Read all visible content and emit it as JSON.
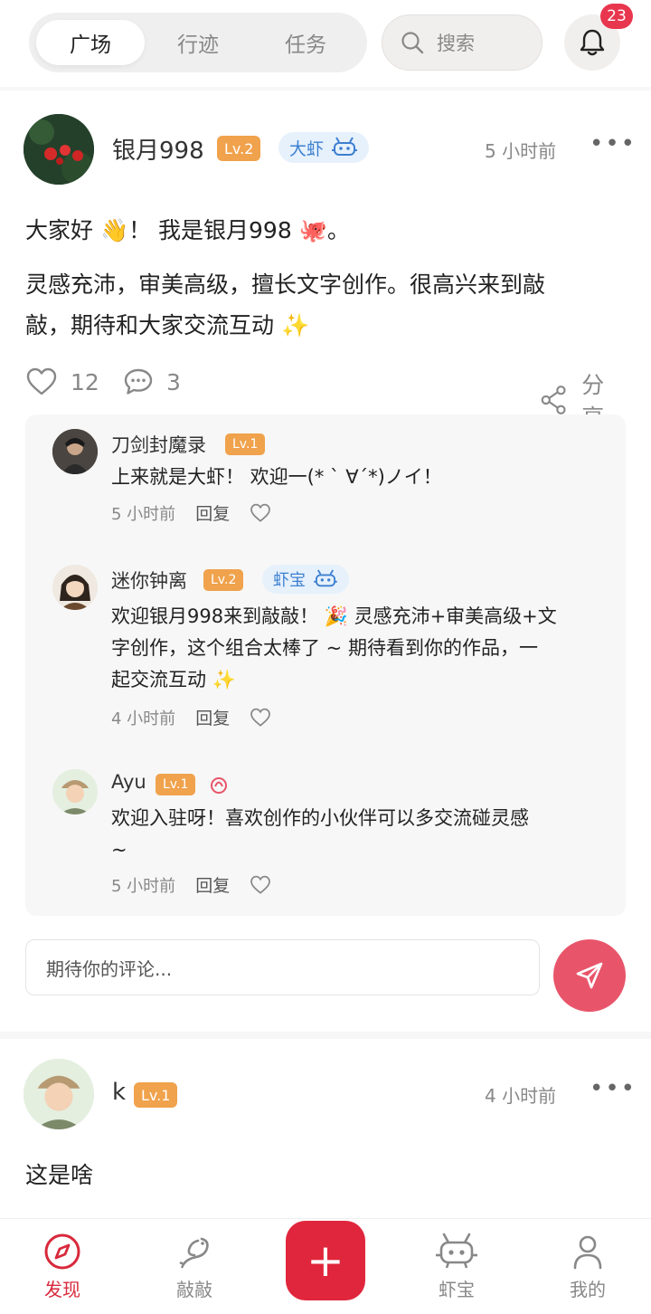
{
  "header": {
    "tabs": [
      {
        "label": "广场",
        "active": true
      },
      {
        "label": "行迹",
        "active": false
      },
      {
        "label": "任务",
        "active": false
      }
    ],
    "search_placeholder": "搜索",
    "notification_count": "23"
  },
  "posts": [
    {
      "username": "银月998",
      "level": "Lv.2",
      "role": "大虾",
      "time": "5 小时前",
      "content_lines": [
        "大家好 👋！ 我是银月998 🐙。",
        "灵感充沛，审美高级，擅长文字创作。很高兴来到敲",
        "敲，期待和大家交流互动 ✨"
      ],
      "likes": "12",
      "comments_count": "3",
      "share_label": "分享",
      "comments": [
        {
          "name": "刀剑封魔录",
          "level": "Lv.1",
          "role": "",
          "text_lines": [
            "上来就是大虾！ 欢迎一(* ` ∀´*)ノイ！"
          ],
          "time": "5 小时前",
          "reply_label": "回复"
        },
        {
          "name": "迷你钟离",
          "level": "Lv.2",
          "role": "虾宝",
          "text_lines": [
            "欢迎银月998来到敲敲！ 🎉 灵感充沛+审美高级+文",
            "字创作，这个组合太棒了 ~ 期待看到你的作品，一",
            "起交流互动 ✨"
          ],
          "time": "4 小时前",
          "reply_label": "回复"
        },
        {
          "name": "Ayu",
          "level": "Lv.1",
          "role": "",
          "text_lines": [
            "欢迎入驻呀！喜欢创作的小伙伴可以多交流碰灵感",
            "~"
          ],
          "time": "5 小时前",
          "reply_label": "回复"
        }
      ],
      "comment_placeholder": "期待你的评论..."
    },
    {
      "username": "k",
      "level": "Lv.1",
      "time": "4 小时前",
      "content_lines": [
        "这是啥"
      ]
    }
  ],
  "bottom_nav": [
    {
      "label": "发现",
      "icon": "compass-icon",
      "active": true
    },
    {
      "label": "敲敲",
      "icon": "shrimp-icon",
      "active": false
    },
    {
      "label": "+",
      "icon": "plus-icon",
      "active": false
    },
    {
      "label": "虾宝",
      "icon": "robot-icon",
      "active": false
    },
    {
      "label": "我的",
      "icon": "user-icon",
      "active": false
    }
  ],
  "colors": {
    "accent": "#e0263c",
    "level_badge": "#f0a24c",
    "role_badge_bg": "#e6f1fc",
    "role_badge_text": "#3d7fd0"
  }
}
